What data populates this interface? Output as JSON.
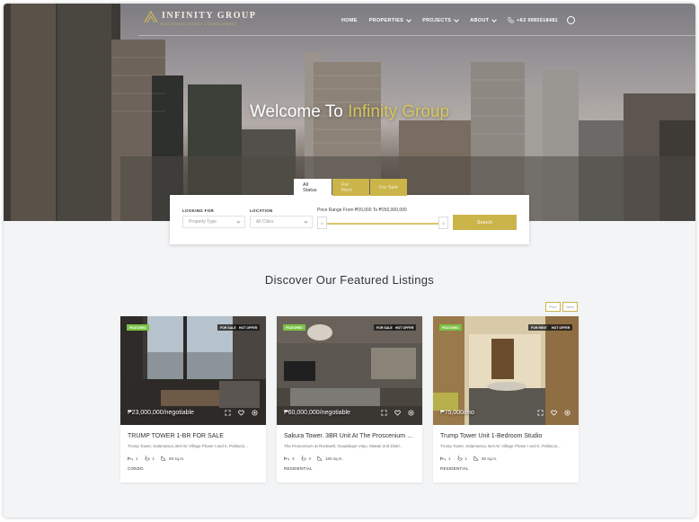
{
  "brand": {
    "name": "INFINITY GROUP",
    "tagline": "REAL ESTATE AGENCY & DEVELOPMENT"
  },
  "nav": {
    "items": [
      {
        "label": "HOME",
        "dropdown": false
      },
      {
        "label": "PROPERTIES",
        "dropdown": true
      },
      {
        "label": "PROJECTS",
        "dropdown": true
      },
      {
        "label": "ABOUT",
        "dropdown": true
      }
    ],
    "phone": "+63 9985518481",
    "phone_icon": "phone-icon",
    "globe_icon": "globe-icon"
  },
  "hero": {
    "title_prefix": "Welcome To ",
    "title_accent": "Infinity Group"
  },
  "search": {
    "tabs": [
      "All Status",
      "For Rent",
      "For Sale"
    ],
    "looking_for_label": "LOOKING FOR",
    "looking_for_placeholder": "Property Type",
    "location_label": "LOCATION",
    "location_placeholder": "All Cities",
    "price_label": "Price Range From ₱20,000 To ₱250,000,000",
    "price_min_handle": "0",
    "price_max_handle": "0",
    "button_label": "Search"
  },
  "featured": {
    "title": "Discover Our Featured Listings",
    "prev_label": "Prev",
    "next_label": "Next",
    "listings": [
      {
        "badges": [
          "FEATURED",
          "FOR SALE",
          "HOT OFFER"
        ],
        "price": "₱23,000,000/negotiable",
        "title": "TRUMP TOWER 1-BR FOR SALE",
        "address": "Trump Tower, Salamanca, Bel-Air Village Phase I and II, Poblacio...",
        "beds": "1",
        "baths": "1",
        "area": "58 sq.m.",
        "type": "CONDO"
      },
      {
        "badges": [
          "FEATURED",
          "FOR SALE",
          "HOT OFFER"
        ],
        "price": "₱60,000,000/negotiable",
        "title": "Sakura Tower. 3BR Unit At The Proscenium ...",
        "address": "The Proscenium at Rockwell, Guadalupe Viejo, Makati 2nd Distri...",
        "beds": "3",
        "baths": "3",
        "area": "160 sq.m.",
        "type": "RESIDENTIAL"
      },
      {
        "badges": [
          "FEATURED",
          "FOR RENT",
          "HOT OFFER"
        ],
        "price": "₱75,000/mo",
        "title": "Trump Tower Unit 1-Bedroom Studio",
        "address": "Trump Tower, Salamanca, Bel-Air Village Phase I and II, Poblacio...",
        "beds": "1",
        "baths": "1",
        "area": "65 sq.m.",
        "type": "RESIDENTIAL"
      }
    ]
  },
  "colors": {
    "accent": "#cbb44a",
    "featured_badge": "#7ac142",
    "title_accent": "#d7c65a"
  }
}
